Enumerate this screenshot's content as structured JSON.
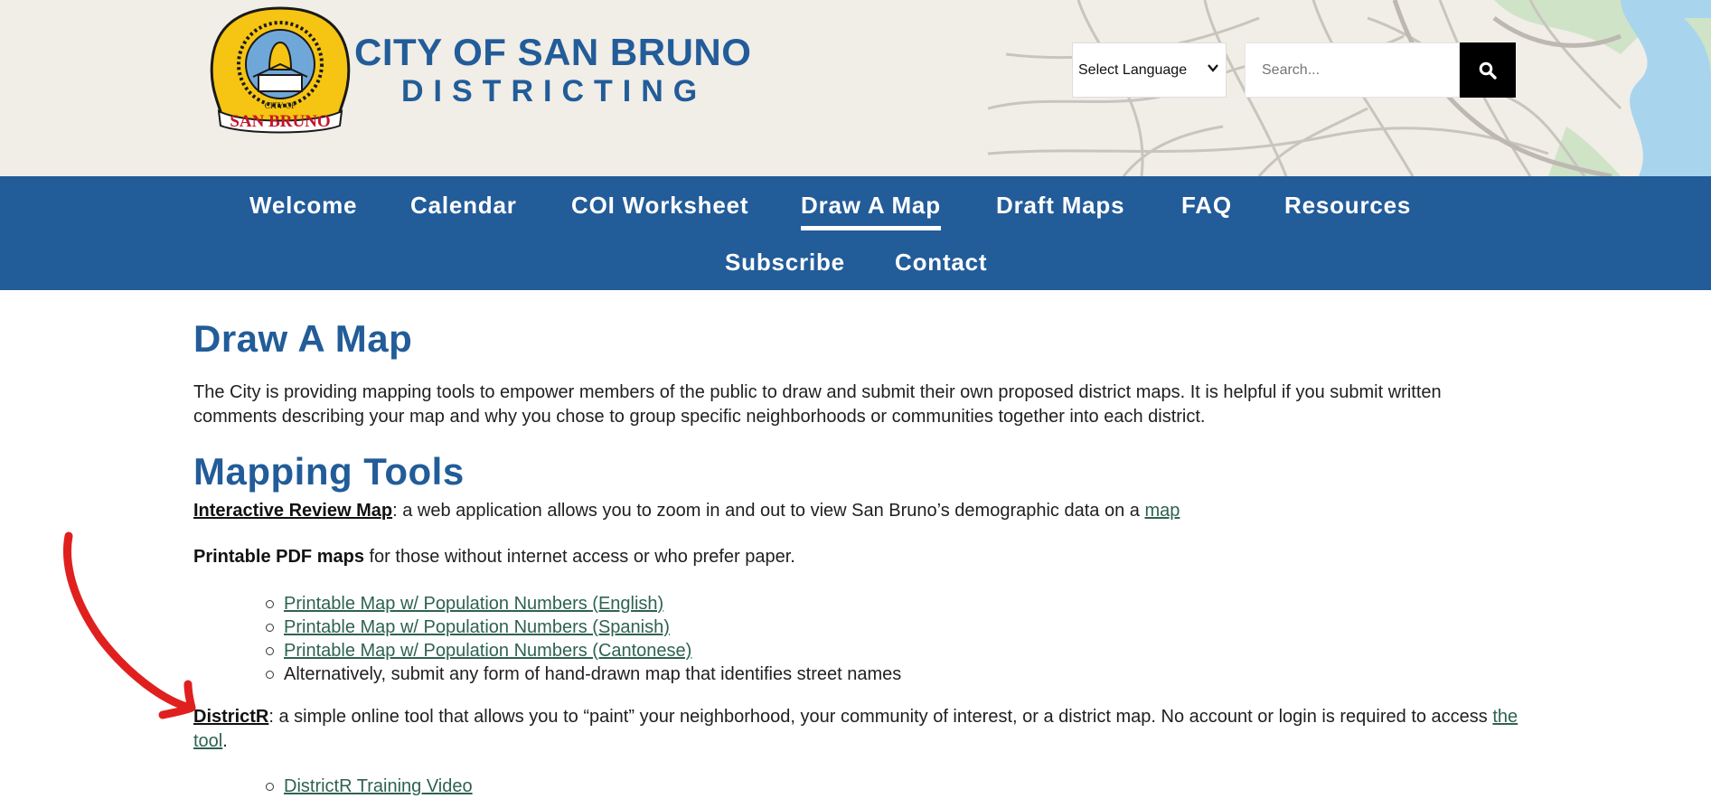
{
  "header": {
    "logo_text_top": "CITY OF",
    "logo_text_bottom": "SAN BRUNO",
    "title_line1": "CITY OF SAN BRUNO",
    "title_line2": "DISTRICTING",
    "language_select": {
      "selected": "Select Language"
    },
    "search": {
      "placeholder": "Search..."
    },
    "colors": {
      "brand_blue": "#225c99",
      "header_bg": "#f1ede7"
    }
  },
  "nav": {
    "items": [
      {
        "label": "Welcome"
      },
      {
        "label": "Calendar"
      },
      {
        "label": "COI Worksheet"
      },
      {
        "label": "Draw A Map",
        "active": true
      },
      {
        "label": "Draft Maps"
      },
      {
        "label": "FAQ"
      },
      {
        "label": "Resources"
      },
      {
        "label": "Subscribe"
      },
      {
        "label": "Contact"
      }
    ]
  },
  "main": {
    "page_title": "Draw A Map",
    "intro": "The City is providing mapping tools to empower members of the public to draw and submit their own proposed district maps. It is helpful if you submit written comments describing your map and why you chose to group specific neighborhoods or communities together into each district.",
    "section_title": "Mapping Tools",
    "interactive": {
      "link": "Interactive Review Map",
      "text": ": a web application allows you to zoom in and out to view San Bruno’s demographic data on a ",
      "map_link": "map"
    },
    "printable": {
      "bold": "Printable PDF maps",
      "text": " for those without internet access or who prefer paper."
    },
    "printable_list": [
      "Printable Map w/ Population Numbers (English)",
      "Printable Map w/ Population Numbers (Spanish)",
      "Printable Map w/ Population Numbers (Cantonese)",
      "Alternatively, submit any form of hand-drawn map that identifies street names"
    ],
    "districtr": {
      "link": "DistrictR",
      "text": ": a simple online tool that allows you to “paint” your neighborhood, your community of interest, or a district map. No account or login is required to access ",
      "tool_link": "the tool",
      "end": "."
    },
    "districtr_list": [
      "DistrictR Training Video"
    ],
    "link_color": "#2e6251",
    "annotation_color": "#e0201f"
  }
}
